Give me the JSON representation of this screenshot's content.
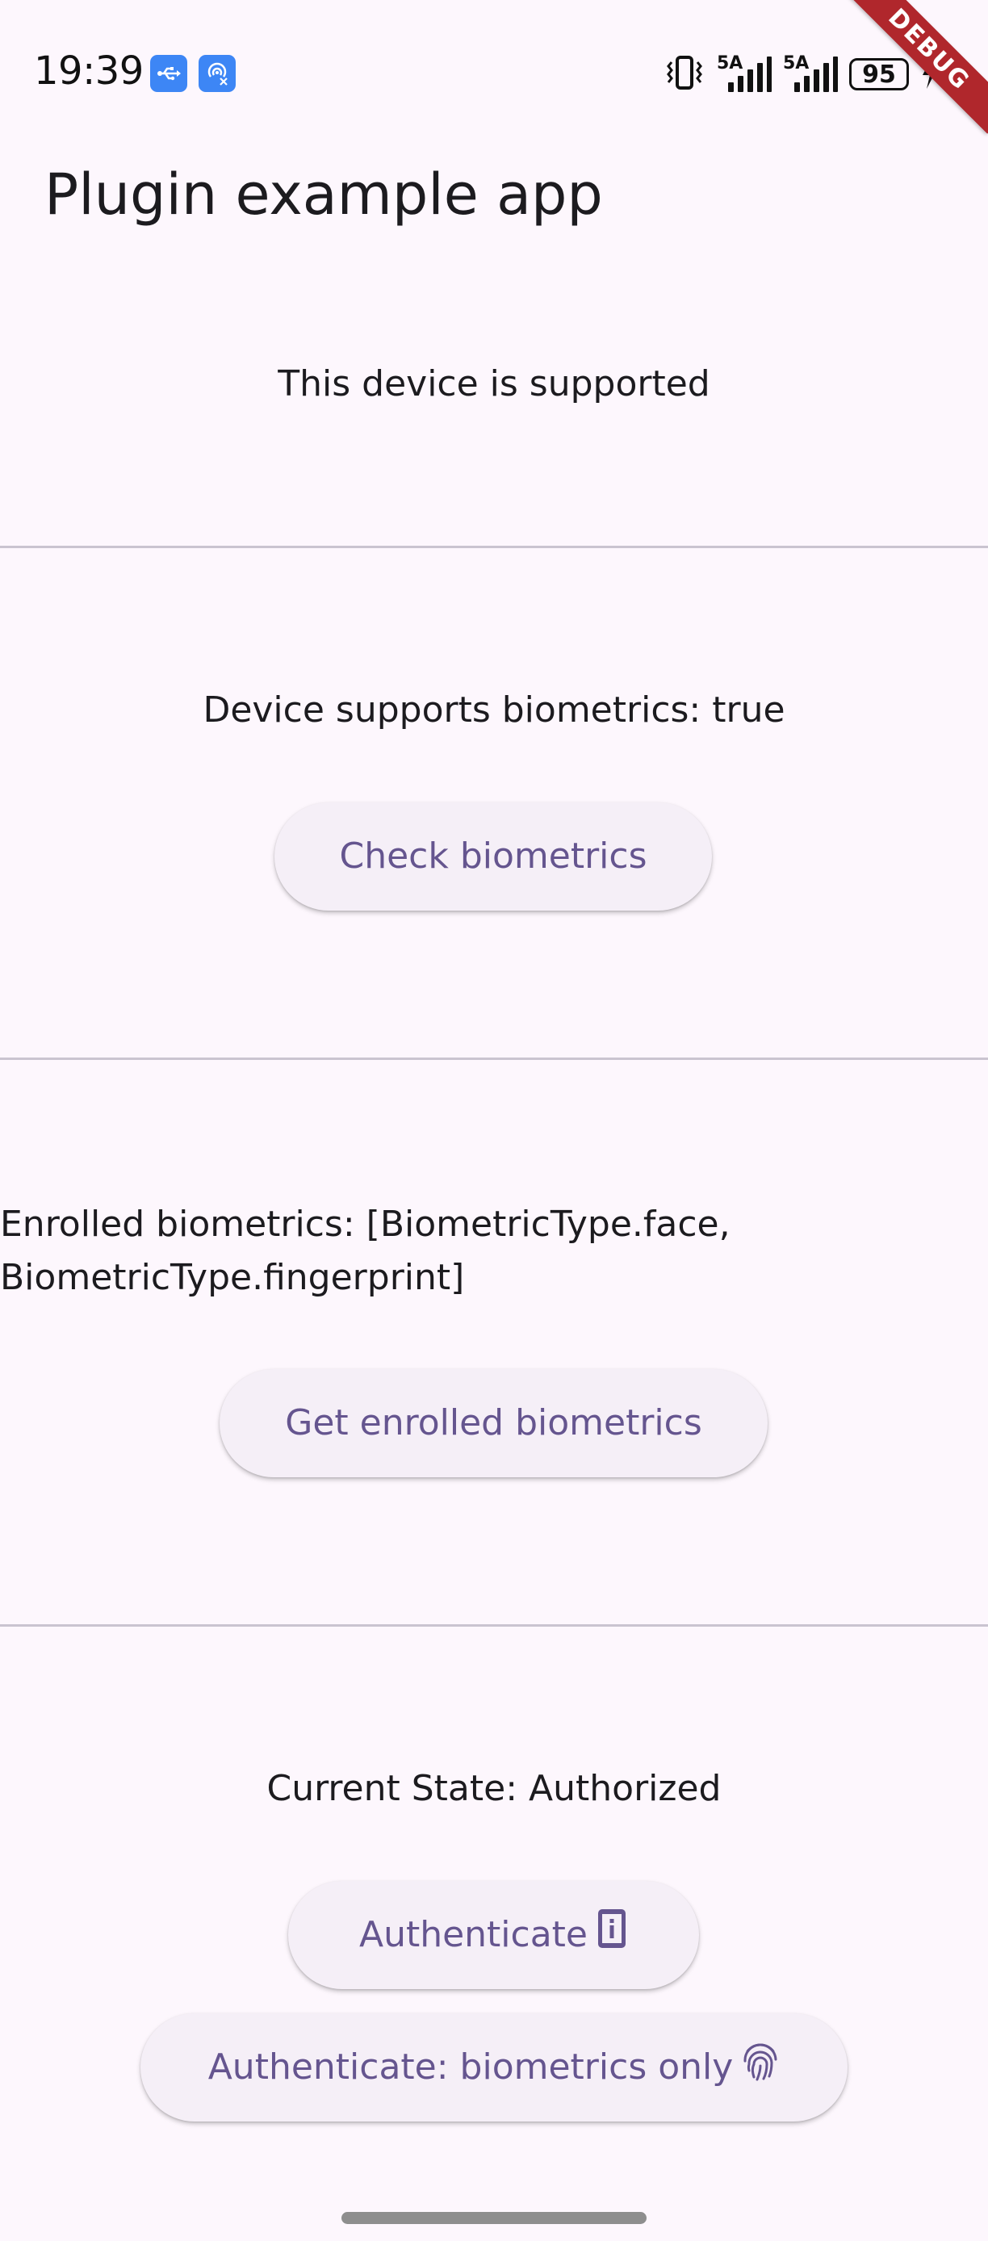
{
  "status_bar": {
    "time": "19:39",
    "battery_level": "95",
    "network_1": "5A",
    "network_2": "5A"
  },
  "debug_banner": "DEBUG",
  "app_bar": {
    "title": "Plugin example app"
  },
  "sections": {
    "device_support": "This device is supported",
    "biometrics_support": "Device supports biometrics: true",
    "check_biometrics_button": "Check biometrics",
    "enrolled_biometrics_line1": "Enrolled biometrics: [BiometricType.face,",
    "enrolled_biometrics_line2": "BiometricType.fingerprint]",
    "get_enrolled_button": "Get enrolled biometrics",
    "current_state": "Current State: Authorized",
    "authenticate_button": "Authenticate",
    "authenticate_biometrics_button": "Authenticate: biometrics only"
  },
  "icons": {
    "usb": "usb-icon",
    "hotspot": "hotspot-off-icon",
    "vibrate": "vibrate-icon",
    "charging": "charging-bolt-icon",
    "perm_device_information": "perm-device-information-icon",
    "fingerprint": "fingerprint-icon"
  },
  "colors": {
    "background": "#fdf7fd",
    "button_bg": "#f5eff7",
    "primary_text": "#65558f",
    "divider": "#cac4d0",
    "debug": "#b0272c",
    "status_icon_bg": "#3d86f5"
  }
}
